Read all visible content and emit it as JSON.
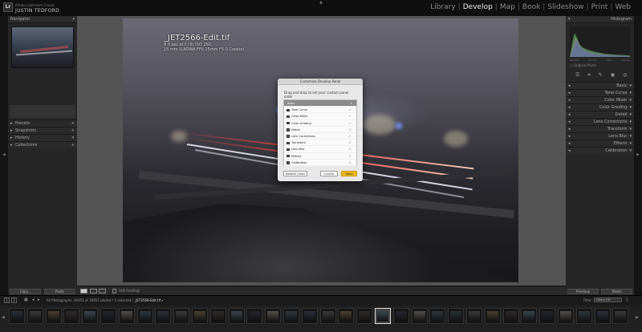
{
  "identity": {
    "small": "Adobe Lightroom Classic",
    "name": "JUSTIN TEDFORD"
  },
  "modules": [
    "Library",
    "Develop",
    "Map",
    "Book",
    "Slideshow",
    "Print",
    "Web"
  ],
  "active_module": "Develop",
  "left_panel": {
    "navigator": "Navigator",
    "sections": [
      "Presets",
      "Snapshots",
      "History",
      "Collections"
    ],
    "copy_label": "Copy...",
    "paste_label": "Paste"
  },
  "right_panel": {
    "histogram": "Histogram",
    "histo_labels": [
      "ISO 250",
      "15 mm",
      "f/8.0",
      "1/8 sec"
    ],
    "original_photo": "Original Photo",
    "items": [
      "Basic",
      "Tone Curve",
      "Color Mixer",
      "Color Grading",
      "Detail",
      "Lens Corrections",
      "Transform",
      "Lens Blur",
      "Effects",
      "Calibration"
    ],
    "previous_label": "Previous",
    "reset_label": "Reset"
  },
  "photo_info": {
    "filename": "_JET2566-Edit.tif",
    "line1": "8.0 sec at f / 8, ISO 250",
    "line2": "15 mm (LAOWA FFII 15mm F5.0 Cookie)"
  },
  "dialog": {
    "title": "Customize Develop Panel",
    "desc": "Drag and drop to set your custom panel order",
    "header": "Basic",
    "items": [
      "Tone Curve",
      "Color Mixer",
      "Color Grading",
      "Detail",
      "Lens Corrections",
      "Transform",
      "Lens Blur",
      "Effects",
      "Calibration"
    ],
    "default_order": "Default Order",
    "cancel": "Cancel",
    "save": "Save",
    "check_glyph": "✓",
    "search_glyph": "⌕"
  },
  "toolbar": {
    "soft_proofing": "Soft Proofing"
  },
  "filmstrip": {
    "num1": "1",
    "num2": "2",
    "source": "All Photographs",
    "count": "30955 of 30955 photos / 1 selected /",
    "file": "_JET2566-Edit.tif",
    "filter_label": "Filter :",
    "filter_value": "Filters Off"
  },
  "colors": {
    "accent": "#e8b71a",
    "active_text": "#f0f0f0",
    "panel": "#262626"
  }
}
